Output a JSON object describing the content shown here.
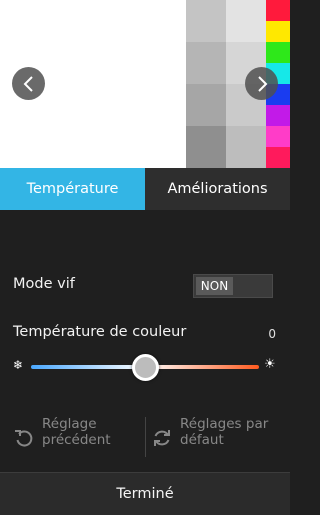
{
  "preview": {
    "gray_levels": [
      "#c4c4c4",
      "#e3e3e3",
      "#b5b5b5",
      "#d6d6d6",
      "#a6a6a6",
      "#cacaca",
      "#8f8f8f",
      "#bdbdbd"
    ],
    "color_bars": [
      "#ff1a3c",
      "#ffe800",
      "#2ee81a",
      "#16e8e8",
      "#1a3cf0",
      "#c21ae8",
      "#ff3cc8",
      "#ff1a5c"
    ],
    "prev_icon": "chevron-left-icon",
    "next_icon": "chevron-right-icon"
  },
  "tabs": [
    {
      "label": "Température",
      "active": true
    },
    {
      "label": "Améliorations",
      "active": false
    }
  ],
  "vivid_mode": {
    "label": "Mode vif",
    "state_text": "NON",
    "enabled": false
  },
  "color_temperature": {
    "label": "Température de couleur",
    "value_text": "0",
    "value": 0,
    "min_icon": "snowflake-icon",
    "max_icon": "sun-icon",
    "gradient": [
      "#4aa8ff",
      "#ffffff",
      "#ff5a1e"
    ]
  },
  "actions": {
    "previous_setting": "Réglage précédent",
    "default_settings": "Réglages par défaut"
  },
  "footer": {
    "done_label": "Terminé"
  },
  "colors": {
    "accent": "#33b5e5",
    "background": "#1f1f1f"
  }
}
